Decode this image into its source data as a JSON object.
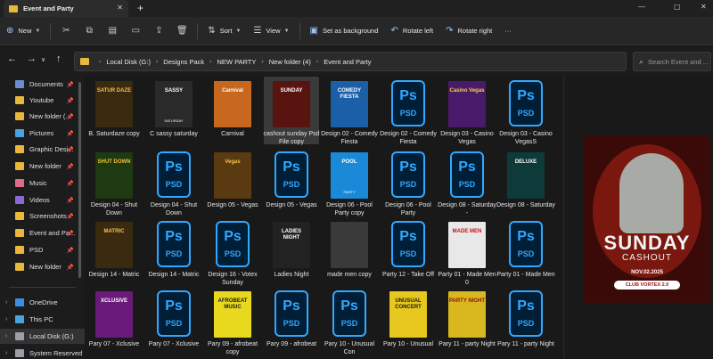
{
  "window": {
    "tab_title": "Event and Party",
    "new_tab_glyph": "+",
    "close_glyph": "✕",
    "controls": [
      "—",
      "▢",
      "✕"
    ]
  },
  "commandbar": {
    "new_label": "New",
    "sort_label": "Sort",
    "view_label": "View",
    "set_background_label": "Set as background",
    "rotate_left_label": "Rotate left",
    "rotate_right_label": "Rotate right",
    "more_glyph": "···",
    "icons": [
      "cut-icon",
      "copy-icon",
      "paste-icon",
      "rename-icon",
      "share-icon",
      "delete-icon"
    ]
  },
  "address": {
    "breadcrumbs": [
      "Local Disk (G:)",
      "Designs Pack",
      "NEW PARTY",
      "New folder (4)",
      "Event and Party"
    ],
    "search_placeholder": "Search Event and ..."
  },
  "sidebar": {
    "items": [
      {
        "label": "Documents",
        "icon": "documents-icon",
        "color": "#6a8fd0",
        "pinned": true
      },
      {
        "label": "Youtube",
        "icon": "folder-icon",
        "color": "#e8b83a",
        "pinned": true
      },
      {
        "label": "New folder (...",
        "icon": "folder-icon",
        "color": "#e8b83a",
        "pinned": true
      },
      {
        "label": "Pictures",
        "icon": "pictures-icon",
        "color": "#4aa3e0",
        "pinned": true
      },
      {
        "label": "Graphic Desi...",
        "icon": "folder-icon",
        "color": "#e8b83a",
        "pinned": true
      },
      {
        "label": "New folder",
        "icon": "folder-icon",
        "color": "#e8b83a",
        "pinned": true
      },
      {
        "label": "Music",
        "icon": "music-icon",
        "color": "#e06a8a",
        "pinned": true
      },
      {
        "label": "Videos",
        "icon": "videos-icon",
        "color": "#8a6ad8",
        "pinned": true
      },
      {
        "label": "Screenshots",
        "icon": "folder-icon",
        "color": "#e8b83a",
        "pinned": true
      },
      {
        "label": "Event and Pa...",
        "icon": "folder-icon",
        "color": "#e8b83a",
        "pinned": true
      },
      {
        "label": "PSD",
        "icon": "folder-icon",
        "color": "#e8b83a",
        "pinned": true
      },
      {
        "label": "New folder",
        "icon": "folder-icon",
        "color": "#e8b83a",
        "pinned": true
      }
    ],
    "bottom_items": [
      {
        "label": "OneDrive",
        "icon": "cloud-icon",
        "color": "#3b8ee8"
      },
      {
        "label": "This PC",
        "icon": "pc-icon",
        "color": "#4aa3e0"
      },
      {
        "label": "Local Disk (G:)",
        "icon": "drive-icon",
        "color": "#9aa0a6"
      },
      {
        "label": "System Reserved",
        "icon": "drive-icon",
        "color": "#9aa0a6"
      }
    ]
  },
  "files": [
    {
      "label": "B. Saturdaze copy",
      "kind": "image",
      "title": "SATUR DAZE",
      "sub": "",
      "bg": "#3a2a10",
      "fg": "#f2c14e"
    },
    {
      "label": "C sassy saturday",
      "kind": "image",
      "title": "SASSY",
      "sub": "SATURDAY",
      "bg": "#2a2a2a",
      "fg": "#ffffff"
    },
    {
      "label": "Carnival",
      "kind": "image",
      "title": "Carnival",
      "sub": "",
      "bg": "#c8681e",
      "fg": "#ffffff"
    },
    {
      "label": "cashout sunday Psd File copy",
      "kind": "image",
      "title": "SUNDAY",
      "sub": "",
      "bg": "#5a1410",
      "fg": "#ffffff",
      "selected": true
    },
    {
      "label": "Design 02 - Comedy Fiesta",
      "kind": "image",
      "title": "COMEDY FIESTA",
      "sub": "",
      "bg": "#1a5fa8",
      "fg": "#ffffff"
    },
    {
      "label": "Design 02 - Comedy Fiesta",
      "kind": "psd"
    },
    {
      "label": "Design 03 - Casino Vegas",
      "kind": "image",
      "title": "Casino Vegas",
      "sub": "",
      "bg": "#4a1a6a",
      "fg": "#f6d24a"
    },
    {
      "label": "Design 03 - Casino VegasS",
      "kind": "psd"
    },
    {
      "label": "Design 04 - Shut Down",
      "kind": "image",
      "title": "SHUT DOWN",
      "sub": "",
      "bg": "#1e3a12",
      "fg": "#f0c23a"
    },
    {
      "label": "Design 04 - Shut Down",
      "kind": "psd"
    },
    {
      "label": "Design 05 - Vegas",
      "kind": "image",
      "title": "Vegas",
      "sub": "",
      "bg": "#5a3a10",
      "fg": "#f2c14e"
    },
    {
      "label": "Design 05 - Vegas",
      "kind": "psd"
    },
    {
      "label": "Design 06 - Pool Party copy",
      "kind": "image",
      "title": "POOL",
      "sub": "PARTY",
      "bg": "#1a8ad8",
      "fg": "#ffffff"
    },
    {
      "label": "Design 06 - Pool Party",
      "kind": "psd"
    },
    {
      "label": "Design 08 - Saturday -",
      "kind": "psd"
    },
    {
      "label": "Design 08 - Saturday",
      "kind": "image",
      "title": "DELUXE",
      "sub": "",
      "bg": "#0e3a3a",
      "fg": "#ffffff"
    },
    {
      "label": "Design 14 - Matric",
      "kind": "image",
      "title": "MATRIC",
      "sub": "",
      "bg": "#3a2a10",
      "fg": "#f2c14e"
    },
    {
      "label": "Design 14 - Matric",
      "kind": "psd"
    },
    {
      "label": "Design 16 - Votex Sunday",
      "kind": "psd"
    },
    {
      "label": "Ladies Night",
      "kind": "image",
      "title": "LADIES NIGHT",
      "sub": "",
      "bg": "#222222",
      "fg": "#ffffff"
    },
    {
      "label": "made men copy",
      "kind": "image",
      "title": "",
      "sub": "",
      "bg": "#3a3a3a",
      "fg": "#ffffff"
    },
    {
      "label": "Party 12 - Take Off",
      "kind": "psd"
    },
    {
      "label": "Party 01 - Made Men 0",
      "kind": "image",
      "title": "MADE MEN",
      "sub": "",
      "bg": "#e8e8e8",
      "fg": "#c81414"
    },
    {
      "label": "Party 01 - Made Men",
      "kind": "psd"
    },
    {
      "label": "Pary 07 - Xclusive",
      "kind": "image",
      "title": "XCLUSIVE",
      "sub": "",
      "bg": "#6a1a7a",
      "fg": "#ffffff"
    },
    {
      "label": "Pary 07 - Xclusive",
      "kind": "psd"
    },
    {
      "label": "Pary 09 - afrobeat copy",
      "kind": "image",
      "title": "AFROBEAT MUSIC",
      "sub": "",
      "bg": "#e8d81e",
      "fg": "#1a1a1a"
    },
    {
      "label": "Pary 09 - afrobeat",
      "kind": "psd"
    },
    {
      "label": "Pary 10 - Unusual Con",
      "kind": "psd"
    },
    {
      "label": "Pary 10 - Unusual",
      "kind": "image",
      "title": "UNUSUAL CONCERT",
      "sub": "",
      "bg": "#e8c81e",
      "fg": "#1a1a1a"
    },
    {
      "label": "Pary 11 - party Night",
      "kind": "image",
      "title": "PARTY NIGHT",
      "sub": "",
      "bg": "#d8b81e",
      "fg": "#8a1414"
    },
    {
      "label": "Pary 11 - party Night",
      "kind": "psd"
    }
  ],
  "psd_icon": {
    "big": "Ps",
    "small": "PSD"
  },
  "preview": {
    "title": "SUNDAY",
    "subtitle": "CASHOUT",
    "date": "NOV.02.2025",
    "venue": "CLUB VORTEX 2.0"
  }
}
